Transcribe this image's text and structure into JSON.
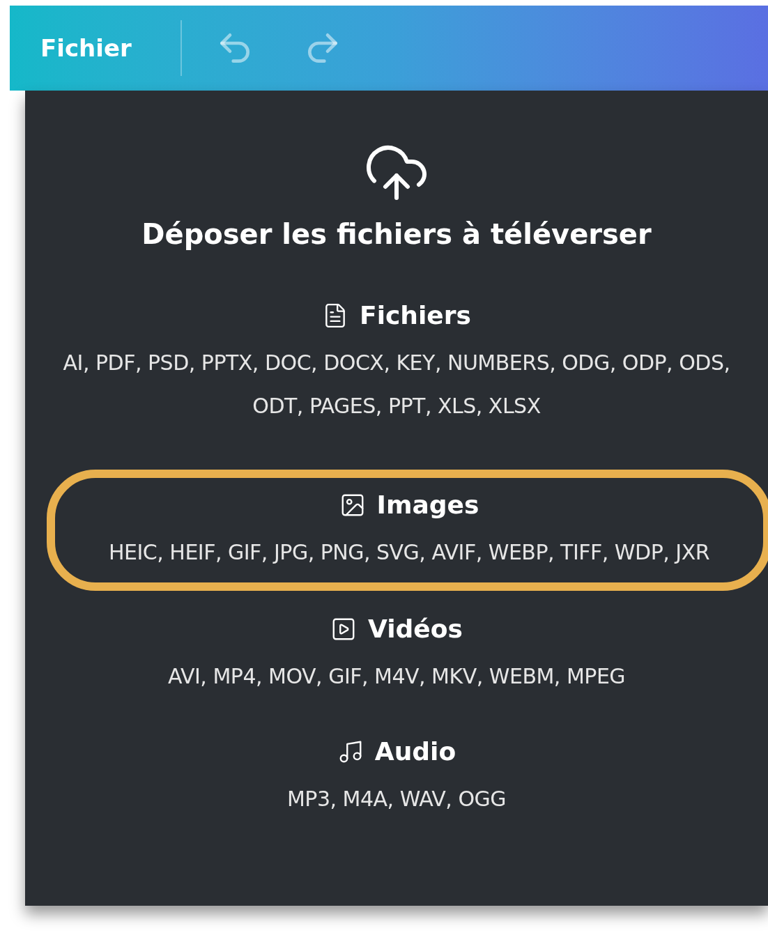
{
  "toolbar": {
    "menu": "Fichier"
  },
  "upload": {
    "title": "Déposer les fichiers à téléverser"
  },
  "sections": [
    {
      "kind": "files",
      "title": "Fichiers",
      "formats": "AI, PDF, PSD, PPTX, DOC, DOCX, KEY, NUMBERS, ODG, ODP, ODS, ODT, PAGES, PPT, XLS, XLSX",
      "highlighted": false
    },
    {
      "kind": "images",
      "title": "Images",
      "formats": "HEIC, HEIF, GIF, JPG, PNG, SVG, AVIF, WEBP, TIFF, WDP, JXR",
      "highlighted": true
    },
    {
      "kind": "videos",
      "title": "Vidéos",
      "formats": "AVI, MP4, MOV, GIF, M4V, MKV, WEBM, MPEG",
      "highlighted": false
    },
    {
      "kind": "audio",
      "title": "Audio",
      "formats": "MP3, M4A, WAV, OGG",
      "highlighted": false
    }
  ]
}
